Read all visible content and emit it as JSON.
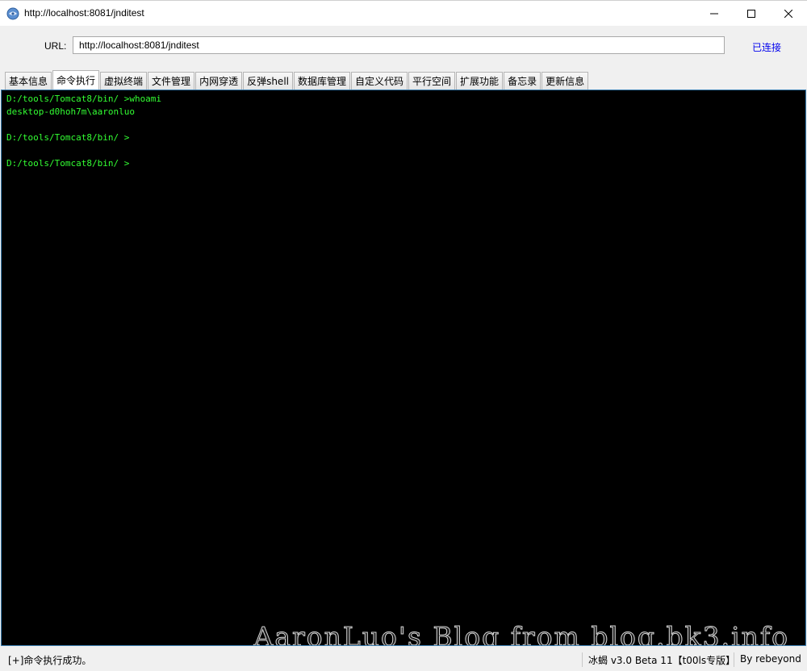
{
  "window": {
    "title": "http://localhost:8081/jnditest"
  },
  "urlbar": {
    "label": "URL:",
    "value": "http://localhost:8081/jnditest",
    "connection_status": "已连接"
  },
  "tabs": [
    {
      "label": "基本信息",
      "active": false
    },
    {
      "label": "命令执行",
      "active": true
    },
    {
      "label": "虚拟终端",
      "active": false
    },
    {
      "label": "文件管理",
      "active": false
    },
    {
      "label": "内网穿透",
      "active": false
    },
    {
      "label": "反弹shell",
      "active": false
    },
    {
      "label": "数据库管理",
      "active": false
    },
    {
      "label": "自定义代码",
      "active": false
    },
    {
      "label": "平行空间",
      "active": false
    },
    {
      "label": "扩展功能",
      "active": false
    },
    {
      "label": "备忘录",
      "active": false
    },
    {
      "label": "更新信息",
      "active": false
    }
  ],
  "terminal": {
    "lines": [
      "D:/tools/Tomcat8/bin/ >whoami",
      "desktop-d0hoh7m\\aaronluo",
      "",
      "D:/tools/Tomcat8/bin/ >",
      "",
      "D:/tools/Tomcat8/bin/ >"
    ],
    "watermark": "AaronLuo's Blog from blog.bk3.info"
  },
  "statusbar": {
    "message": "[+]命令执行成功。",
    "version": "冰蝎 v3.0 Beta 11【t00ls专版】",
    "author": "By rebeyond"
  },
  "colors": {
    "terminal_bg": "#000000",
    "terminal_text": "#33ff33",
    "link": "#0000ee",
    "terminal_border": "#3c7fb1"
  }
}
